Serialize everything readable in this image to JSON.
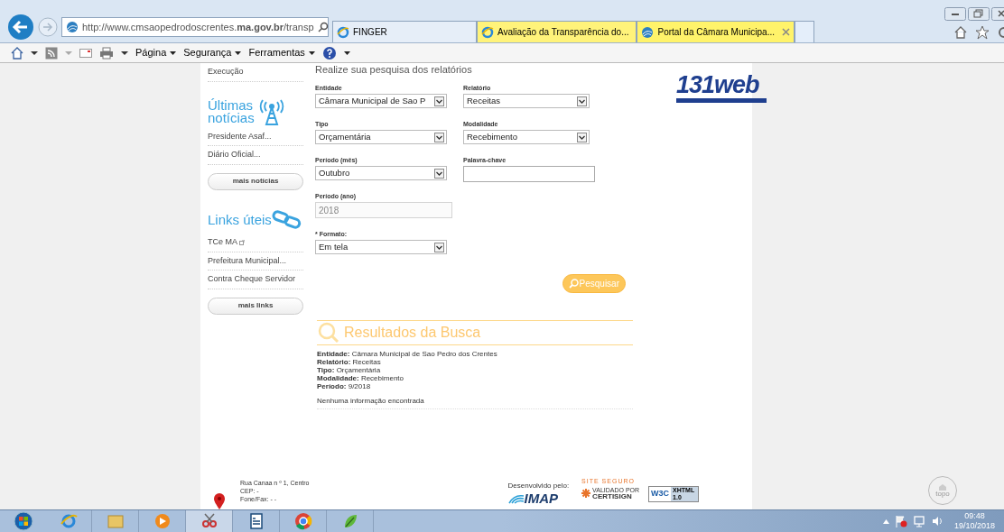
{
  "browser": {
    "address": "http://www.cmsaopedrodoscrentes.**ma.gov.br**/transp",
    "tabs": [
      {
        "label": "FINGER",
        "selected": false
      },
      {
        "label": "Avaliação da Transparência do...",
        "selected": false
      },
      {
        "label": "Portal da Câmara Municipa...",
        "selected": true
      }
    ],
    "command_bar": [
      "Página",
      "Segurança",
      "Ferramentas"
    ]
  },
  "sidebar": {
    "top_link": "Execução",
    "news": {
      "title_lines": [
        "Últimas",
        "notícias"
      ],
      "items": [
        "Presidente Asaf...",
        "Diário Oficial..."
      ],
      "button": "mais notícias"
    },
    "links": {
      "title": "Links úteis",
      "items": [
        {
          "label": "TCe MA",
          "external": true
        },
        {
          "label": "Prefeitura Municipal...",
          "external": false
        },
        {
          "label": "Contra Cheque Servidor",
          "external": false
        }
      ],
      "button": "mais links"
    }
  },
  "form": {
    "heading": "Realize sua pesquisa dos relatórios",
    "left_fields": [
      {
        "kind": "select",
        "label": "Entidade",
        "value": "Câmara Municipal de Sao P"
      },
      {
        "kind": "select",
        "label": "Tipo",
        "value": "Orçamentária"
      },
      {
        "kind": "select",
        "label": "Período (mês)",
        "value": "Outubro"
      },
      {
        "kind": "input",
        "label": "Período (ano)",
        "value": "2018",
        "disabled": true
      },
      {
        "kind": "select",
        "label": "* Formato:",
        "value": "Em tela"
      }
    ],
    "right_fields": [
      {
        "kind": "select",
        "label": "Relatório",
        "value": "Receitas"
      },
      {
        "kind": "select",
        "label": "Modalidade",
        "value": "Recebimento"
      },
      {
        "kind": "input",
        "label": "Palavra-chave",
        "disabled": false
      }
    ],
    "search_button": "Pesquisar"
  },
  "logo": {
    "text": "131web"
  },
  "results": {
    "title": "Resultados da Busca",
    "summary": [
      {
        "label": "Entidade:",
        "value": "Câmara Municipal de Sao Pedro dos Crentes"
      },
      {
        "label": "Relatório:",
        "value": "Receitas"
      },
      {
        "label": "Tipo:",
        "value": "Orçamentária"
      },
      {
        "label": "Modalidade:",
        "value": "Recebimento"
      },
      {
        "label": "Período:",
        "value": "9/2018"
      }
    ],
    "message": "Nenhuma informação encontrada"
  },
  "footer": {
    "address_lines": [
      "Rua Canaa n º 1, Centro",
      "CEP: -",
      "Fone/Fax: - -"
    ],
    "developed_by": "Desenvolvido pelo:",
    "imap": "IMAP",
    "site_seguro": "SITE SEGURO",
    "validado": "VALIDADO POR",
    "certisign": "CERTISIGN",
    "w3c": "W3C",
    "xhtml": "XHTML 1.0",
    "top_button": "topo"
  },
  "taskbar": {
    "time": "09:48",
    "date": "19/10/2018"
  }
}
